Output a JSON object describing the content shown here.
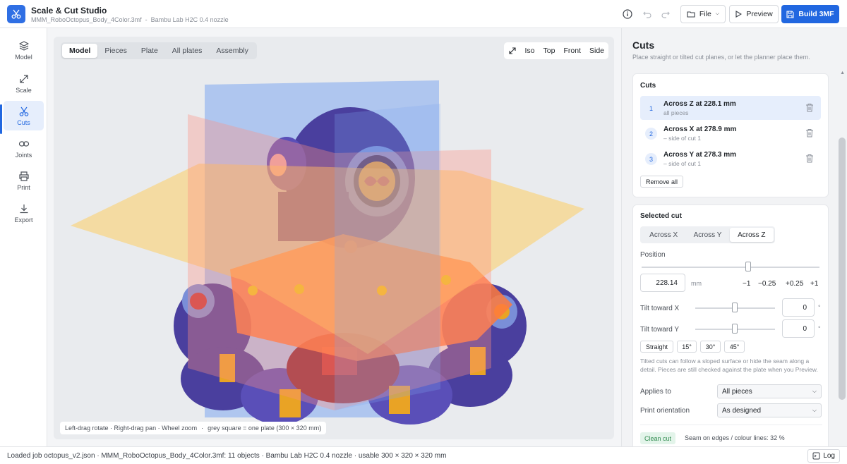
{
  "app": {
    "title": "Scale & Cut Studio",
    "file_name": "MMM_RoboOctopus_Body_4Color.3mf",
    "separator": "-",
    "printer": "Bambu Lab H2C 0.4 nozzle"
  },
  "toolbar": {
    "file_label": "File",
    "preview_label": "Preview",
    "build_label": "Build 3MF"
  },
  "nav": [
    {
      "label": "Model",
      "icon": "stack-icon"
    },
    {
      "label": "Scale",
      "icon": "resize-icon"
    },
    {
      "label": "Cuts",
      "icon": "scissors-icon"
    },
    {
      "label": "Joints",
      "icon": "link-icon"
    },
    {
      "label": "Print",
      "icon": "printer-icon"
    },
    {
      "label": "Export",
      "icon": "download-icon"
    }
  ],
  "viewport": {
    "tabs": [
      "Model",
      "Pieces",
      "Plate",
      "All plates",
      "Assembly"
    ],
    "views": [
      "Iso",
      "Top",
      "Front",
      "Side"
    ],
    "hint_controls": "Left-drag rotate · Right-drag pan · Wheel zoom",
    "hint_dot": "·",
    "hint_plate": "grey square = one plate (300 × 320 mm)"
  },
  "panel": {
    "title": "Cuts",
    "subtitle": "Place straight or tilted cut planes, or let the planner place them.",
    "cuts_heading": "Cuts",
    "cuts": [
      {
        "num": "1",
        "title": "Across Z at 228.1 mm",
        "sub": "all pieces"
      },
      {
        "num": "2",
        "title": "Across X at 278.9 mm",
        "sub": "– side of cut 1"
      },
      {
        "num": "3",
        "title": "Across Y at 278.3 mm",
        "sub": "– side of cut 1"
      }
    ],
    "remove_all": "Remove all",
    "selected_heading": "Selected cut",
    "axis_options": [
      "Across X",
      "Across Y",
      "Across Z"
    ],
    "position_label": "Position",
    "position_value": "228.14",
    "position_fraction": 0.6,
    "unit": "mm",
    "steps": [
      "−1",
      "−0.25",
      "+0.25",
      "+1"
    ],
    "tilt_x_label": "Tilt toward X",
    "tilt_x_value": "0",
    "tilt_y_label": "Tilt toward Y",
    "tilt_y_value": "0",
    "degree": "°",
    "presets": [
      "Straight",
      "15°",
      "30°",
      "45°"
    ],
    "help": "Tilted cuts can follow a sloped surface or hide the seam along a detail. Pieces are still checked against the plate when you Preview.",
    "applies_label": "Applies to",
    "applies_value": "All pieces",
    "orientation_label": "Print orientation",
    "orientation_value": "As designed",
    "clean_badge": "Clean cut",
    "seam_text": "Seam on edges / colour lines: 32 %"
  },
  "status": {
    "text": "Loaded job octopus_v2.json · MMM_RoboOctopus_Body_4Color.3mf: 11 objects · Bambu Lab H2C 0.4 nozzle · usable 300 × 320 × 320 mm",
    "log_label": "Log"
  },
  "colors": {
    "accent": "#2167e0",
    "plane_blue": "#7fa8f0",
    "plane_yellow": "#ffcc55",
    "plane_red": "#ff8f80",
    "model_purple": "#4a3f9e",
    "model_orange": "#ff7a3c"
  }
}
